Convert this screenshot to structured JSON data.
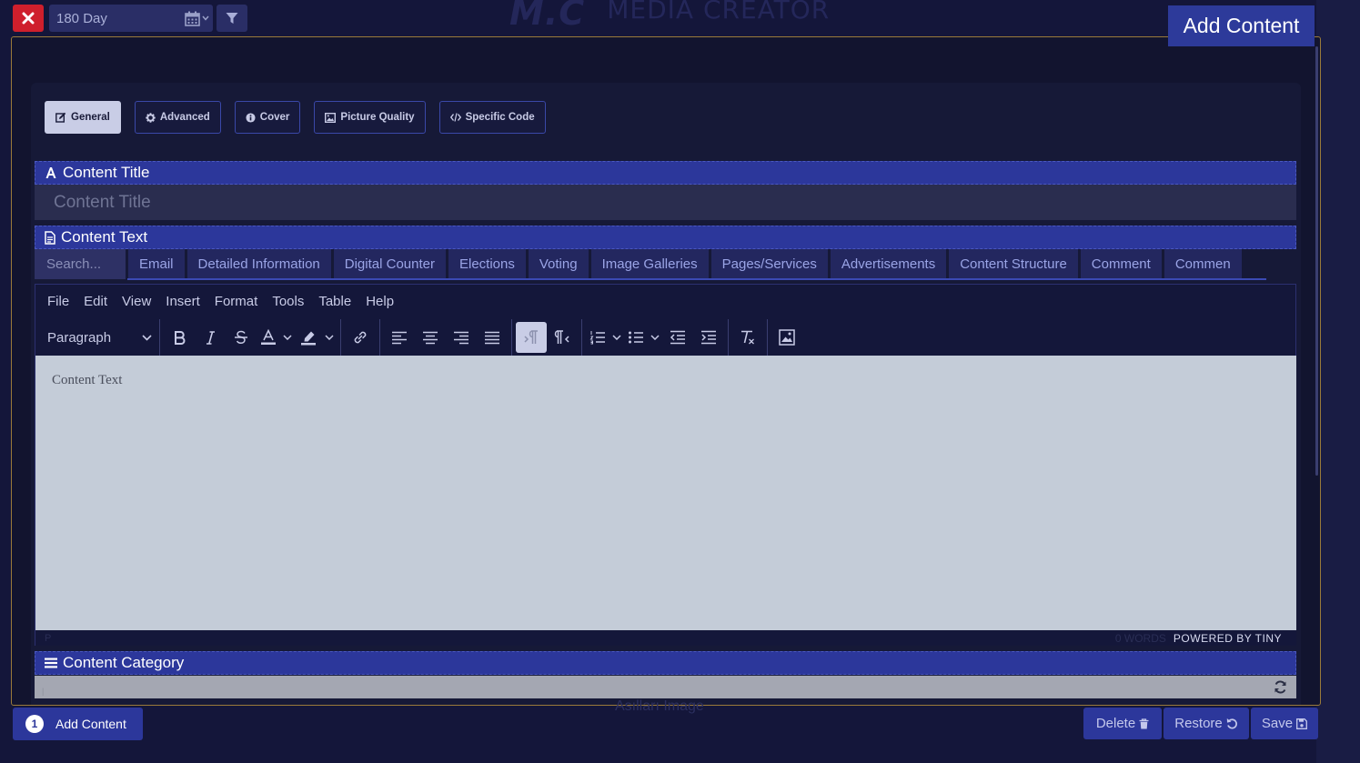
{
  "colors": {
    "accent": "#2c379b",
    "danger": "#cf1f2c",
    "border_gold": "#9a7a3a",
    "editor_bg": "#c4ccd8"
  },
  "brand": {
    "mark": "M.C",
    "name": "MEDIA CREATOR"
  },
  "topbar": {
    "close_icon": "times-icon",
    "date_range": "180 Day",
    "filter_icon": "filter-icon",
    "add_content_label": "Add Content"
  },
  "form_tabs": [
    {
      "label": "General",
      "icon": "edit-icon",
      "active": true
    },
    {
      "label": "Advanced",
      "icon": "gear-icon",
      "active": false
    },
    {
      "label": "Cover",
      "icon": "info-icon",
      "active": false
    },
    {
      "label": "Picture Quality",
      "icon": "image-icon",
      "active": false
    },
    {
      "label": "Specific Code",
      "icon": "code-icon",
      "active": false
    }
  ],
  "content_title": {
    "heading": "Content Title",
    "placeholder": "Content Title"
  },
  "content_text": {
    "heading": "Content Text",
    "search_placeholder": "Search...",
    "tabs": [
      "Email",
      "Detailed Information",
      "Digital Counter",
      "Elections",
      "Voting",
      "Image Galleries",
      "Pages/Services",
      "Advertisements",
      "Content Structure",
      "Comment",
      "Commen"
    ],
    "menus": [
      "File",
      "Edit",
      "View",
      "Insert",
      "Format",
      "Tools",
      "Table",
      "Help"
    ],
    "block_format": "Paragraph",
    "editor_placeholder": "Content Text",
    "status_path": "P",
    "word_count": "0 WORDS",
    "powered_by": "POWERED BY TINY"
  },
  "content_category": {
    "heading": "Content Category",
    "selected": "|"
  },
  "below_text": "Asılları Image",
  "footer": {
    "count": "1",
    "add_content_label": "Add Content",
    "delete_label": "Delete",
    "restore_label": "Restore",
    "save_label": "Save"
  }
}
